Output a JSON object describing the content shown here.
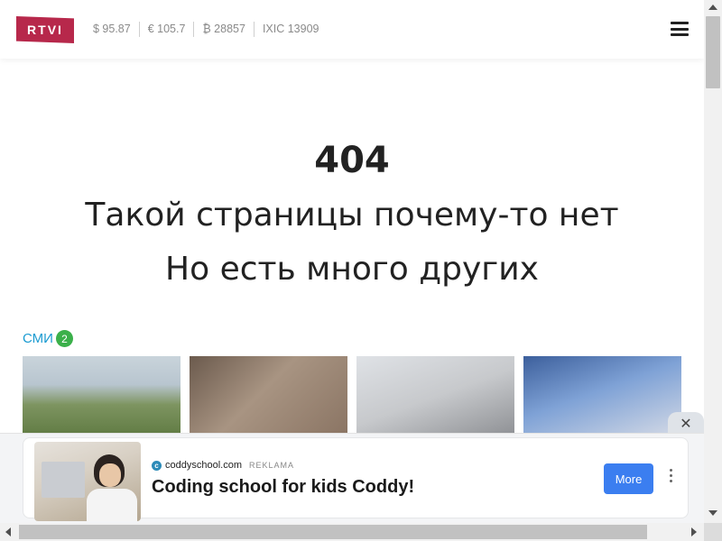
{
  "header": {
    "logo_text": "RTVI",
    "tickers": [
      {
        "label": "$ 95.87"
      },
      {
        "label": "€ 105.7"
      },
      {
        "label": "₿ 28857"
      },
      {
        "label": "IXIC 13909"
      }
    ],
    "menu_icon": "hamburger-menu-icon"
  },
  "error": {
    "code": "404",
    "line1": "Такой страницы почему-то нет",
    "line2": "Но есть много других"
  },
  "section": {
    "title": "СМИ",
    "badge": "2"
  },
  "ad": {
    "domain": "coddyschool.com",
    "label": "REKLAMA",
    "title": "Coding school for kids Coddy!",
    "button": "More",
    "close_icon": "close-icon",
    "more_icon": "kebab-menu-icon"
  },
  "colors": {
    "brand": "#b7284b",
    "section_link": "#1b9bd1",
    "badge": "#3bb04a",
    "ad_button": "#3b7ef0"
  }
}
